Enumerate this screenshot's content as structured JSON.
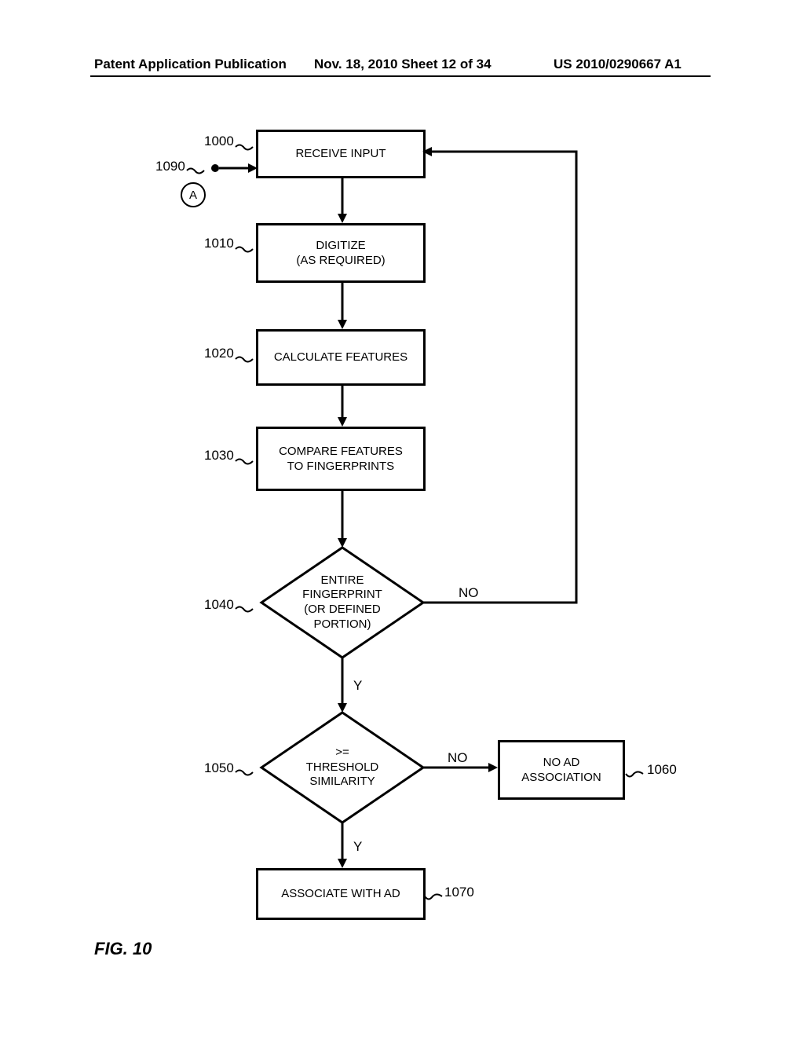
{
  "header": {
    "left": "Patent Application Publication",
    "mid": "Nov. 18, 2010  Sheet 12 of 34",
    "right": "US 2010/0290667 A1"
  },
  "refs": {
    "r1000": "1000",
    "r1010": "1010",
    "r1020": "1020",
    "r1030": "1030",
    "r1040": "1040",
    "r1050": "1050",
    "r1060": "1060",
    "r1070": "1070",
    "r1090": "1090"
  },
  "boxes": {
    "receive": "RECEIVE INPUT",
    "digitize": "DIGITIZE\n(AS REQUIRED)",
    "calc": "CALCULATE FEATURES",
    "compare": "COMPARE FEATURES\nTO FINGERPRINTS",
    "noad": "NO AD\nASSOCIATION",
    "assoc": "ASSOCIATE WITH AD"
  },
  "diamonds": {
    "d1": "ENTIRE\nFINGERPRINT\n(OR DEFINED\nPORTION)",
    "d2": ">=\nTHRESHOLD\nSIMILARITY"
  },
  "edges": {
    "no": "NO",
    "y": "Y"
  },
  "connector": {
    "a": "A"
  },
  "figure": "FIG.  10"
}
